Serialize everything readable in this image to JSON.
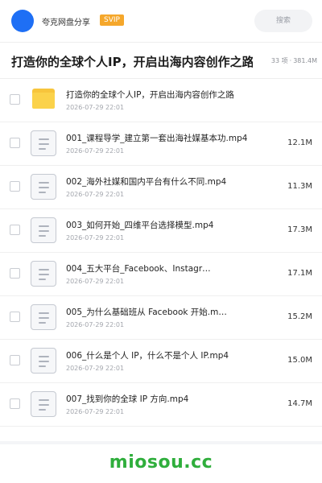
{
  "header": {
    "brand": "夸克网盘分享",
    "badge": "SVIP",
    "search_label": "搜索"
  },
  "titlebar": {
    "title": "打造你的全球个人IP，开启出海内容创作之路！",
    "count": "33 项",
    "separator": "·",
    "total_size": "381.4M"
  },
  "files": [
    {
      "type": "folder",
      "name": "打造你的全球个人IP，开启出海内容创作之路",
      "date": "2026-07-29 22:01",
      "size": ""
    },
    {
      "type": "file",
      "name": "001_课程导学_建立第一套出海社媒基本功.mp4",
      "date": "2026-07-29 22:01",
      "size": "12.1M"
    },
    {
      "type": "file",
      "name": "002_海外社媒和国内平台有什么不同.mp4",
      "date": "2026-07-29 22:01",
      "size": "11.3M"
    },
    {
      "type": "file",
      "name": "003_如何开始_四维平台选择模型.mp4",
      "date": "2026-07-29 22:01",
      "size": "17.3M"
    },
    {
      "type": "file",
      "name": "004_五大平台_Facebook、Instagr…",
      "date": "2026-07-29 22:01",
      "size": "17.1M"
    },
    {
      "type": "file",
      "name": "005_为什么基础班从 Facebook 开始.m…",
      "date": "2026-07-29 22:01",
      "size": "15.2M"
    },
    {
      "type": "file",
      "name": "006_什么是个人 IP，什么不是个人 IP.mp4",
      "date": "2026-07-29 22:01",
      "size": "15.0M"
    },
    {
      "type": "file",
      "name": "007_找到你的全球 IP 方向.mp4",
      "date": "2026-07-29 22:01",
      "size": "14.7M"
    }
  ],
  "watermark": "miosou.cc",
  "colors": {
    "avatar": "#1e6ff5",
    "badge": "#f5a72b",
    "folder": "#fbd24a",
    "watermark": "#2fae3c"
  }
}
